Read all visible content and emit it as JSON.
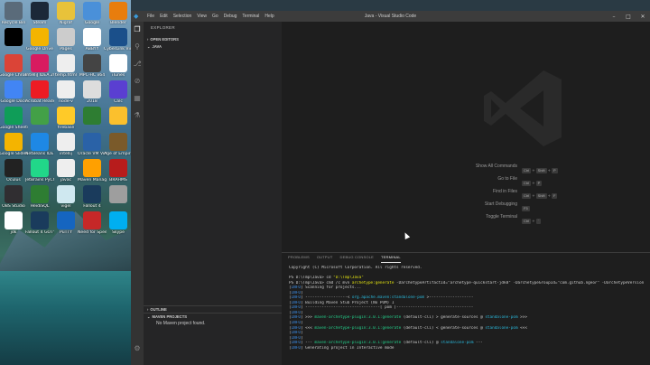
{
  "desktop_icons": [
    {
      "label": "Recycle Bin",
      "color": "#5a6b7a"
    },
    {
      "label": "Steam",
      "color": "#1b2838"
    },
    {
      "label": "Nigraf",
      "color": "#e8c23a"
    },
    {
      "label": "Google",
      "color": "#4a90d9"
    },
    {
      "label": "Blender",
      "color": "#e87d0d"
    },
    {
      "label": "",
      "color": "#000000"
    },
    {
      "label": "Google Drive",
      "color": "#f4b400"
    },
    {
      "label": "Pages",
      "color": "#cccccc"
    },
    {
      "label": "ABBYY",
      "color": "#ffffff"
    },
    {
      "label": "CyberLink Video Editor",
      "color": "#1a4f8a"
    },
    {
      "label": "Google Chrome",
      "color": "#db4437"
    },
    {
      "label": "IntelliJ IDEA 2018",
      "color": "#d81b60"
    },
    {
      "label": "temp.html",
      "color": "#eeeeee"
    },
    {
      "label": "MPC-HC x64",
      "color": "#444444"
    },
    {
      "label": "iTunes",
      "color": "#ffffff"
    },
    {
      "label": "Google Docs",
      "color": "#4285f4"
    },
    {
      "label": "Acrobat Reader DC",
      "color": "#ed1c24"
    },
    {
      "label": "node-v",
      "color": "#eeeeee"
    },
    {
      "label": "2018",
      "color": "#dddddd"
    },
    {
      "label": "Calc",
      "color": "#5a3fd1"
    },
    {
      "label": "Google Sheets",
      "color": "#0f9d58"
    },
    {
      "label": "",
      "color": "#43a047"
    },
    {
      "label": "firebase",
      "color": "#ffca28"
    },
    {
      "label": "",
      "color": "#2e7d32"
    },
    {
      "label": "",
      "color": "#fbc02d"
    },
    {
      "label": "Google Slides",
      "color": "#f4b400"
    },
    {
      "label": "NetBeans IDE 8.2",
      "color": "#1e88e5"
    },
    {
      "label": "intellij",
      "color": "#eeeeee"
    },
    {
      "label": "Oracle VM VirtualBox",
      "color": "#2a62a7"
    },
    {
      "label": "Age of Empires",
      "color": "#7a5a2a"
    },
    {
      "label": "Oculus",
      "color": "#222222"
    },
    {
      "label": "JetBrains PyCharm",
      "color": "#21d789"
    },
    {
      "label": "javac",
      "color": "#eeeeee"
    },
    {
      "label": "Maven Manager",
      "color": "#ffa000"
    },
    {
      "label": "BRAHMS",
      "color": "#b71c1c"
    },
    {
      "label": "OBS Studio",
      "color": "#302e31"
    },
    {
      "label": "HeidiSQL",
      "color": "#2e7d32"
    },
    {
      "label": "vigel",
      "color": "#cfe8f0"
    },
    {
      "label": "Fallout 4",
      "color": "#1a3b5c"
    },
    {
      "label": "",
      "color": "#9e9e9e"
    },
    {
      "label": "jdk",
      "color": "#ffffff"
    },
    {
      "label": "Fallout 4 GOTY",
      "color": "#1a3b5c"
    },
    {
      "label": "PuTTY",
      "color": "#1565c0"
    },
    {
      "label": "Need for Speed",
      "color": "#c62828"
    },
    {
      "label": "Skype",
      "color": "#00aff0"
    }
  ],
  "menu": [
    "File",
    "Edit",
    "Selection",
    "View",
    "Go",
    "Debug",
    "Terminal",
    "Help"
  ],
  "window_title": "Java - Visual Studio Code",
  "sidebar": {
    "header": "EXPLORER",
    "open_editors": "OPEN EDITORS",
    "folder": "JAVA",
    "outline": "OUTLINE",
    "maven": "MAVEN PROJECTS",
    "maven_message": "No Maven project found."
  },
  "shortcuts": [
    {
      "label": "Show All Commands",
      "keys": [
        "Ctrl",
        "Shift",
        "P"
      ]
    },
    {
      "label": "Go to File",
      "keys": [
        "Ctrl",
        "P"
      ]
    },
    {
      "label": "Find in Files",
      "keys": [
        "Ctrl",
        "Shift",
        "F"
      ]
    },
    {
      "label": "Start Debugging",
      "keys": [
        "F5"
      ]
    },
    {
      "label": "Toggle Terminal",
      "keys": [
        "Ctrl",
        "`"
      ]
    }
  ],
  "panel_tabs": [
    "PROBLEMS",
    "OUTPUT",
    "DEBUG CONSOLE",
    "TERMINAL"
  ],
  "panel_active_tab": "TERMINAL",
  "terminal_lines": [
    "Copyright (C) Microsoft Corporation. All rights reserved.",
    "",
    "PS D:\\Tmp\\Java> cd \"D:\\Tmp\\Java\"",
    "PS D:\\Tmp\\Java> cmd /c mvn archetype:generate -DarchetypeArtifactId=\"archetype-quickstart-jdk8\" -DarchetypeGroupId=\"com.github.ngeor\" -DarchetypeVersion",
    "[INFO] Scanning for projects...",
    "[INFO]",
    "[INFO] ------------------< org.apache.maven:standalone-pom >-------------------",
    "[INFO] Building Maven Stub Project (No POM) 1",
    "[INFO] --------------------------------[ pom ]---------------------------------",
    "[INFO]",
    "[INFO] >>> maven-archetype-plugin:3.0.1:generate (default-cli) > generate-sources @ standalone-pom >>>",
    "[INFO]",
    "[INFO] <<< maven-archetype-plugin:3.0.1:generate (default-cli) < generate-sources @ standalone-pom <<<",
    "[INFO]",
    "[INFO]",
    "[INFO] --- maven-archetype-plugin:3.0.1:generate (default-cli) @ standalone-pom ---",
    "[INFO] Generating project in Interactive mode"
  ]
}
